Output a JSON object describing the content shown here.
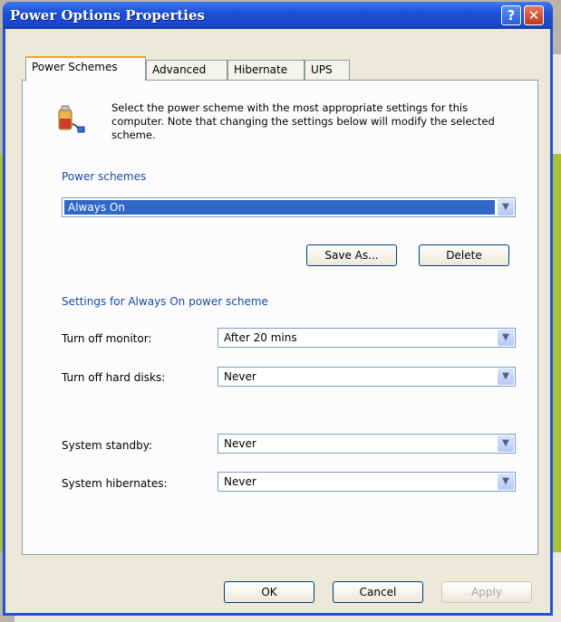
{
  "window": {
    "title": "Power Options Properties",
    "help_glyph": "?",
    "close_glyph": "✕"
  },
  "tabs": [
    {
      "label": "Power Schemes",
      "active": true
    },
    {
      "label": "Advanced",
      "active": false
    },
    {
      "label": "Hibernate",
      "active": false
    },
    {
      "label": "UPS",
      "active": false
    }
  ],
  "intro": {
    "icon": "battery-plug-icon",
    "text": "Select the power scheme with the most appropriate settings for this computer. Note that changing the settings below will modify the selected scheme."
  },
  "schemes": {
    "label": "Power schemes",
    "selected": "Always On",
    "save_as_label": "Save As...",
    "delete_label": "Delete"
  },
  "settings": {
    "heading": "Settings for Always On power scheme",
    "rows": [
      {
        "label": "Turn off monitor:",
        "value": "After 20 mins"
      },
      {
        "label": "Turn off hard disks:",
        "value": "Never"
      },
      {
        "label": "System standby:",
        "value": "Never"
      },
      {
        "label": "System hibernates:",
        "value": "Never"
      }
    ]
  },
  "footer": {
    "ok_label": "OK",
    "cancel_label": "Cancel",
    "apply_label": "Apply"
  },
  "colors": {
    "titlebar": "#1d4fd8",
    "selection": "#3168c5",
    "link_text": "#1c48a8"
  }
}
